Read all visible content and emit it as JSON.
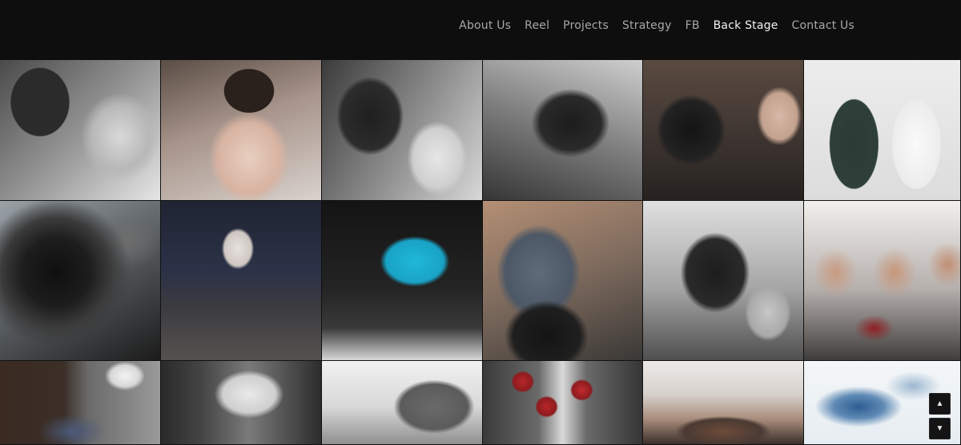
{
  "nav": {
    "items": [
      {
        "label": "About Us",
        "active": false
      },
      {
        "label": "Reel",
        "active": false
      },
      {
        "label": "Projects",
        "active": false
      },
      {
        "label": "Strategy",
        "active": false
      },
      {
        "label": "FB",
        "active": false
      },
      {
        "label": "Back Stage",
        "active": true
      },
      {
        "label": "Contact Us",
        "active": false
      }
    ]
  },
  "gallery": {
    "photos": [
      {
        "subject": "bw-crew-portrait"
      },
      {
        "subject": "actress-reading-card"
      },
      {
        "subject": "bw-camera-rig-actress"
      },
      {
        "subject": "bw-camera-operator"
      },
      {
        "subject": "bw-camera-monitor"
      },
      {
        "subject": "two-crew-portrait"
      },
      {
        "subject": "canon-camera-lens"
      },
      {
        "subject": "laptop-editing"
      },
      {
        "subject": "video-editing-monitor"
      },
      {
        "subject": "crew-holding-camera"
      },
      {
        "subject": "bw-crew-with-boy"
      },
      {
        "subject": "group-selfie"
      },
      {
        "subject": "brick-wall-cafe"
      },
      {
        "subject": "bw-alley"
      },
      {
        "subject": "building-sign"
      },
      {
        "subject": "red-lanterns-street"
      },
      {
        "subject": "crowd-restaurant"
      },
      {
        "subject": "blue-watercolor"
      }
    ]
  },
  "controls": {
    "scroll_up_icon": "▲",
    "scroll_down_icon": "▼"
  },
  "colors": {
    "background": "#0e0e0e",
    "nav_text": "#a8a8a8",
    "nav_active": "#f2f2f2"
  }
}
